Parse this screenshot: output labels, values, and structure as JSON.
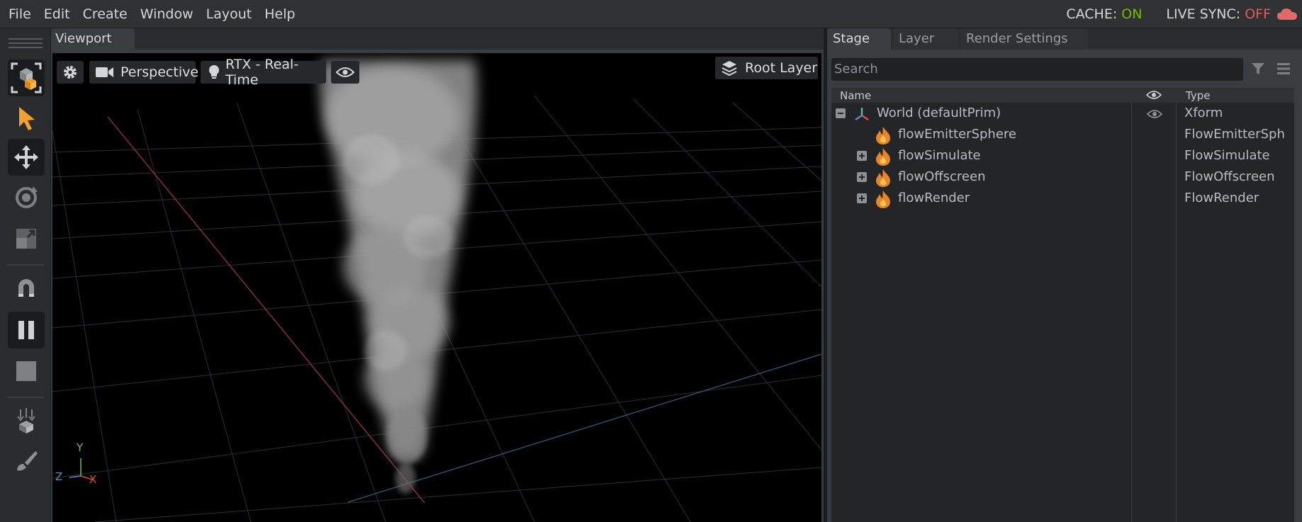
{
  "menubar": {
    "items": [
      "File",
      "Edit",
      "Create",
      "Window",
      "Layout",
      "Help"
    ],
    "cache_label": "CACHE:",
    "cache_value": "ON",
    "live_sync_label": "LIVE SYNC:",
    "live_sync_value": "OFF"
  },
  "toolbar": {
    "tools": [
      "select-mode-icon",
      "select-arrow-icon",
      "move-icon",
      "rotate-icon",
      "scale-icon",
      "snap-magnet-icon",
      "pause-icon",
      "stop-icon",
      "drop-to-ground-icon",
      "paint-brush-icon"
    ]
  },
  "viewport": {
    "tab_label": "Viewport",
    "camera_label": "Perspective",
    "renderer_label": "RTX - Real-Time",
    "layer_label": "Root Layer",
    "axes": {
      "y": "Y",
      "z": "Z",
      "x": "X"
    }
  },
  "stage": {
    "tabs": [
      "Stage",
      "Layer",
      "Render Settings"
    ],
    "search_placeholder": "Search",
    "columns": {
      "name": "Name",
      "type": "Type"
    },
    "rows": [
      {
        "name": "World (defaultPrim)",
        "type": "Xform",
        "expander": "minus"
      },
      {
        "name": "flowEmitterSphere",
        "type": "FlowEmitterSph",
        "expander": "none"
      },
      {
        "name": "flowSimulate",
        "type": "FlowSimulate",
        "expander": "plus"
      },
      {
        "name": "flowOffscreen",
        "type": "FlowOffscreen",
        "expander": "plus"
      },
      {
        "name": "flowRender",
        "type": "FlowRender",
        "expander": "plus"
      }
    ]
  },
  "colors": {
    "accent_green": "#76b900",
    "off_red": "#e35b5b",
    "tool_orange": "#f0a030",
    "x_axis": "#d9534f",
    "y_axis": "#7fb85a",
    "z_axis": "#5b8fd9"
  }
}
